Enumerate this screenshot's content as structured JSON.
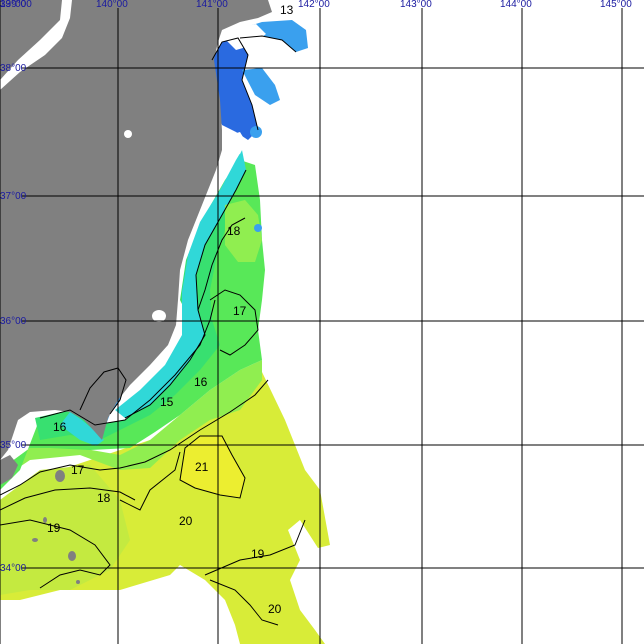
{
  "map": {
    "lon_labels": [
      "139°00",
      "140°00",
      "141°00",
      "142°00",
      "143°00",
      "144°00",
      "145°00"
    ],
    "lat_labels": [
      "39°00",
      "38°00",
      "37°00",
      "36°00",
      "35°00",
      "34°00"
    ],
    "isotherm_labels": [
      "13",
      "18",
      "17",
      "16",
      "15",
      "16",
      "21",
      "17",
      "18",
      "19",
      "20",
      "19",
      "20"
    ],
    "colors": {
      "land": "#808080",
      "ocean_empty": "#ffffff",
      "temp_13": "#2a6ae0",
      "temp_14": "#3aa0ee",
      "temp_15": "#30d8d8",
      "temp_16": "#38e070",
      "temp_17": "#58e858",
      "temp_18": "#90ee50",
      "temp_19": "#c4ea40",
      "temp_20": "#d8ec38",
      "temp_21": "#ecee30"
    }
  }
}
